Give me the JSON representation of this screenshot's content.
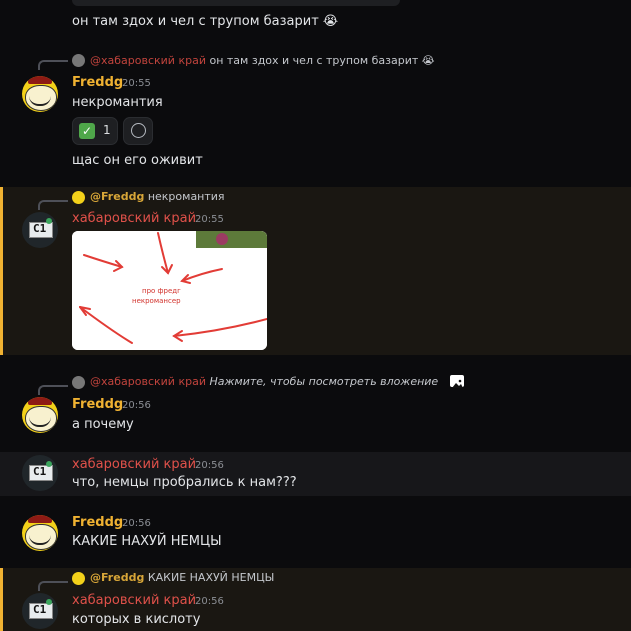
{
  "messages": {
    "top": {
      "text": "он там здох и чел с трупом базарит 😭"
    },
    "m1": {
      "reply_mention": "@хабаровский край",
      "reply_text": "он там здох и чел с трупом базарит 😭",
      "author": "Freddg",
      "time": "20:55",
      "text": "некромантия",
      "reaction_count": "1",
      "text2": "щас он его оживит"
    },
    "m2": {
      "reply_mention": "@Freddg",
      "reply_text": "некромантия",
      "author": "хабаровский край",
      "time": "20:55",
      "image_text_1": "про фредг",
      "image_text_2": "некромансер"
    },
    "m3": {
      "reply_mention": "@хабаровский край",
      "reply_text": "Нажмите, чтобы посмотреть вложение",
      "author": "Freddg",
      "time": "20:56",
      "text": "а почему"
    },
    "m4": {
      "author": "хабаровский край",
      "time": "20:56",
      "text": "что, немцы пробрались к нам???"
    },
    "m5": {
      "author": "Freddg",
      "time": "20:56",
      "text": "КАКИЕ НАХУЙ НЕМЦЫ"
    },
    "m6": {
      "reply_mention": "@Freddg",
      "reply_text": "КАКИЕ НАХУЙ НЕМЦЫ",
      "author": "хабаровский край",
      "time": "20:56",
      "text": "которых в кислоту"
    }
  },
  "avatar_glyph": "C1",
  "colors": {
    "accent": "#f0b232",
    "red_name": "#e0514a",
    "background": "#0b0b0d"
  }
}
